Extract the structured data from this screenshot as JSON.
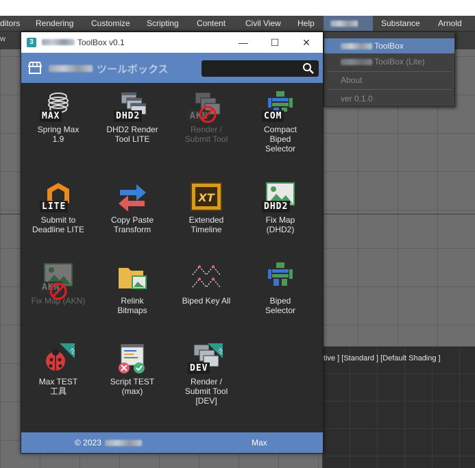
{
  "menubar": {
    "items": [
      "ditors",
      "Rendering",
      "Customize",
      "Scripting",
      "Content",
      "Civil View",
      "Help",
      "Substance",
      "Arnold"
    ]
  },
  "side_label": "w",
  "dropdown": {
    "items": [
      {
        "label": "ToolBox"
      },
      {
        "label": "ToolBox (Lite)"
      },
      {
        "label": "About"
      },
      {
        "label": "ver 0.1.0"
      }
    ]
  },
  "viewport": {
    "label": "tive ] [Standard ] [Default Shading ]"
  },
  "window": {
    "title": "ToolBox v0.1",
    "app_icon_text": "3",
    "controls": {
      "minimize": "—",
      "maximize": "☐",
      "close": "✕"
    },
    "header_title": "ツールボックス",
    "search": {
      "value": "",
      "placeholder": ""
    },
    "footer": {
      "copyright": "© 2023",
      "right": "Max"
    }
  },
  "tools": [
    {
      "label": "Spring Max\n1.9",
      "badge": "MAX",
      "icon": "spring-icon",
      "disabled": false
    },
    {
      "label": "DHD2 Render\nTool LITE",
      "badge": "DHD2",
      "icon": "render-windows-icon",
      "disabled": false
    },
    {
      "label": "Render /\nSubmit Tool",
      "badge": "AKN",
      "icon": "render-windows-icon",
      "disabled": true
    },
    {
      "label": "Compact\nBiped\nSelector",
      "badge": "COM",
      "icon": "biped-icon",
      "disabled": false
    },
    {
      "label": "Submit to\nDeadline LITE",
      "badge": "LITE",
      "icon": "deadline-icon",
      "disabled": false
    },
    {
      "label": "Copy Paste\nTransform",
      "badge": "",
      "icon": "transfer-arrows-icon",
      "disabled": false
    },
    {
      "label": "Extended\nTimeline",
      "badge": "",
      "icon": "timeline-xt-icon",
      "disabled": false
    },
    {
      "label": "Fix Map\n(DHD2)",
      "badge": "DHD2",
      "icon": "image-map-icon",
      "disabled": false
    },
    {
      "label": "Fix Map (AKN)",
      "badge": "AKN",
      "icon": "image-map-icon",
      "disabled": true
    },
    {
      "label": "Relink\nBitmaps",
      "badge": "",
      "icon": "folder-image-icon",
      "disabled": false
    },
    {
      "label": "Biped Key All",
      "badge": "",
      "icon": "curve-keys-icon",
      "disabled": false
    },
    {
      "label": "Biped\nSelector",
      "badge": "",
      "icon": "biped-icon",
      "disabled": false
    },
    {
      "label": "Max TEST\n工具",
      "badge": "",
      "icon": "ladybug-icon",
      "disabled": false
    },
    {
      "label": "Script TEST\n(max)",
      "badge": "",
      "icon": "script-test-icon",
      "disabled": false
    },
    {
      "label": "Render /\nSubmit Tool\n[DEV]",
      "badge": "DEV",
      "icon": "render-windows-icon",
      "disabled": false
    }
  ]
}
